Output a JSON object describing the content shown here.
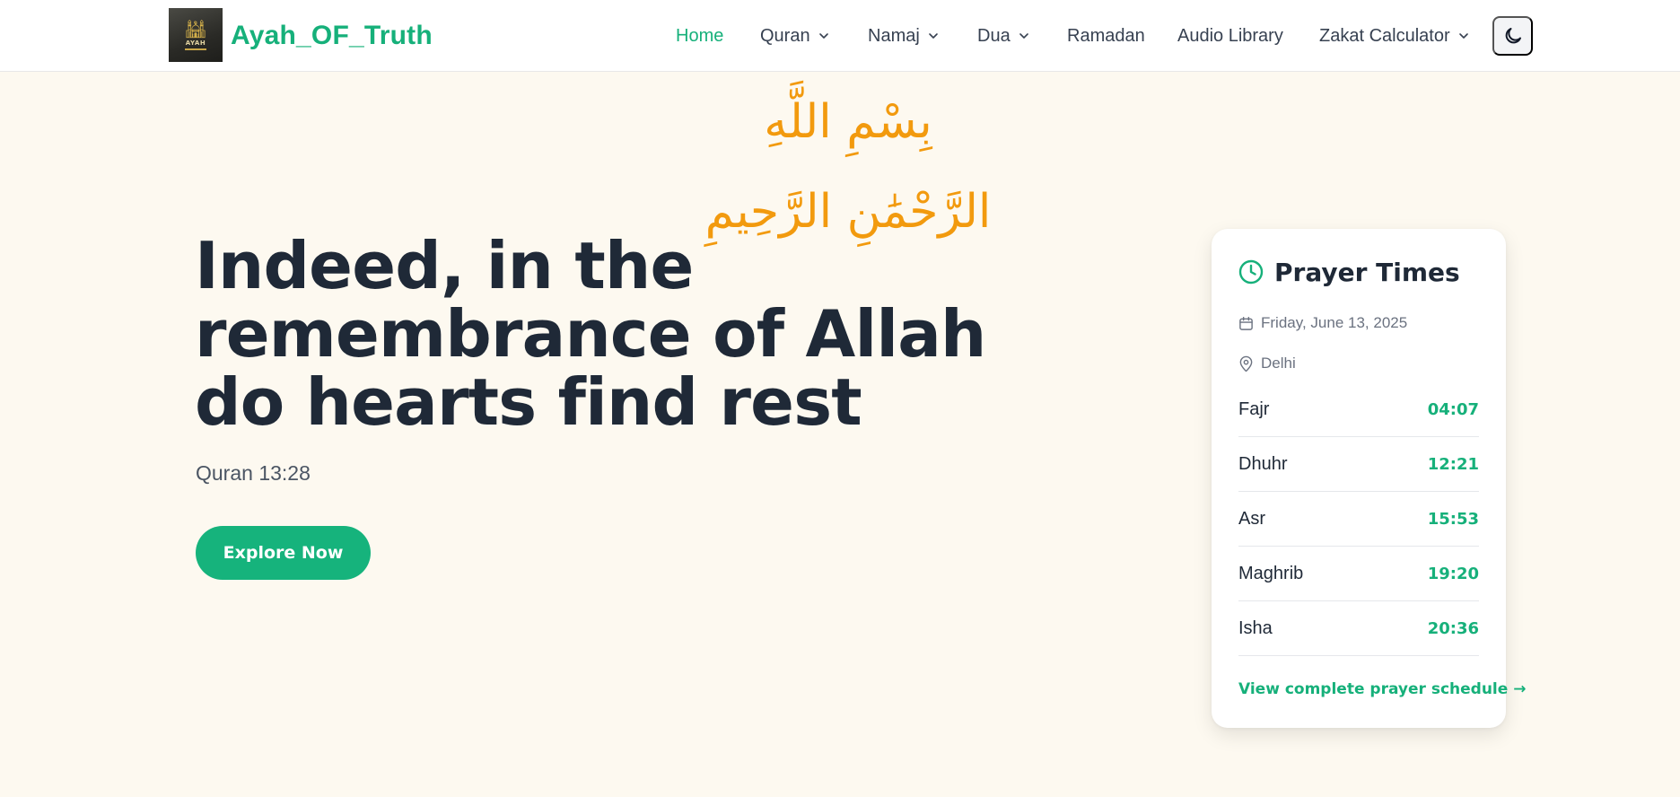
{
  "brand": {
    "name": "Ayah_OF_Truth",
    "logo_text": "AYAH"
  },
  "nav": {
    "items": [
      {
        "label": "Home",
        "active": true,
        "has_dropdown": false
      },
      {
        "label": "Quran",
        "active": false,
        "has_dropdown": true
      },
      {
        "label": "Namaj",
        "active": false,
        "has_dropdown": true
      },
      {
        "label": "Dua",
        "active": false,
        "has_dropdown": true
      },
      {
        "label": "Ramadan",
        "active": false,
        "has_dropdown": false
      },
      {
        "label": "Audio Library",
        "active": false,
        "has_dropdown": false
      },
      {
        "label": "Zakat Calculator",
        "active": false,
        "has_dropdown": true
      }
    ],
    "theme_toggle_icon": "moon-icon"
  },
  "bismillah": "بِسْمِ اللَّهِ الرَّحْمَٰنِ الرَّحِيمِ",
  "hero": {
    "title": "Indeed, in the remembrance of Allah do hearts find rest",
    "reference": "Quran 13:28",
    "button_label": "Explore Now"
  },
  "prayer_card": {
    "title": "Prayer Times",
    "date": "Friday, June 13, 2025",
    "location": "Delhi",
    "prayers": [
      {
        "name": "Fajr",
        "time": "04:07"
      },
      {
        "name": "Dhuhr",
        "time": "12:21"
      },
      {
        "name": "Asr",
        "time": "15:53"
      },
      {
        "name": "Maghrib",
        "time": "19:20"
      },
      {
        "name": "Isha",
        "time": "20:36"
      }
    ],
    "link_label": "View complete prayer schedule →"
  },
  "colors": {
    "accent": "#16b07a",
    "page_background": "#fdf9f0",
    "bismillah": "#f29a0e",
    "heading": "#1f2937"
  }
}
